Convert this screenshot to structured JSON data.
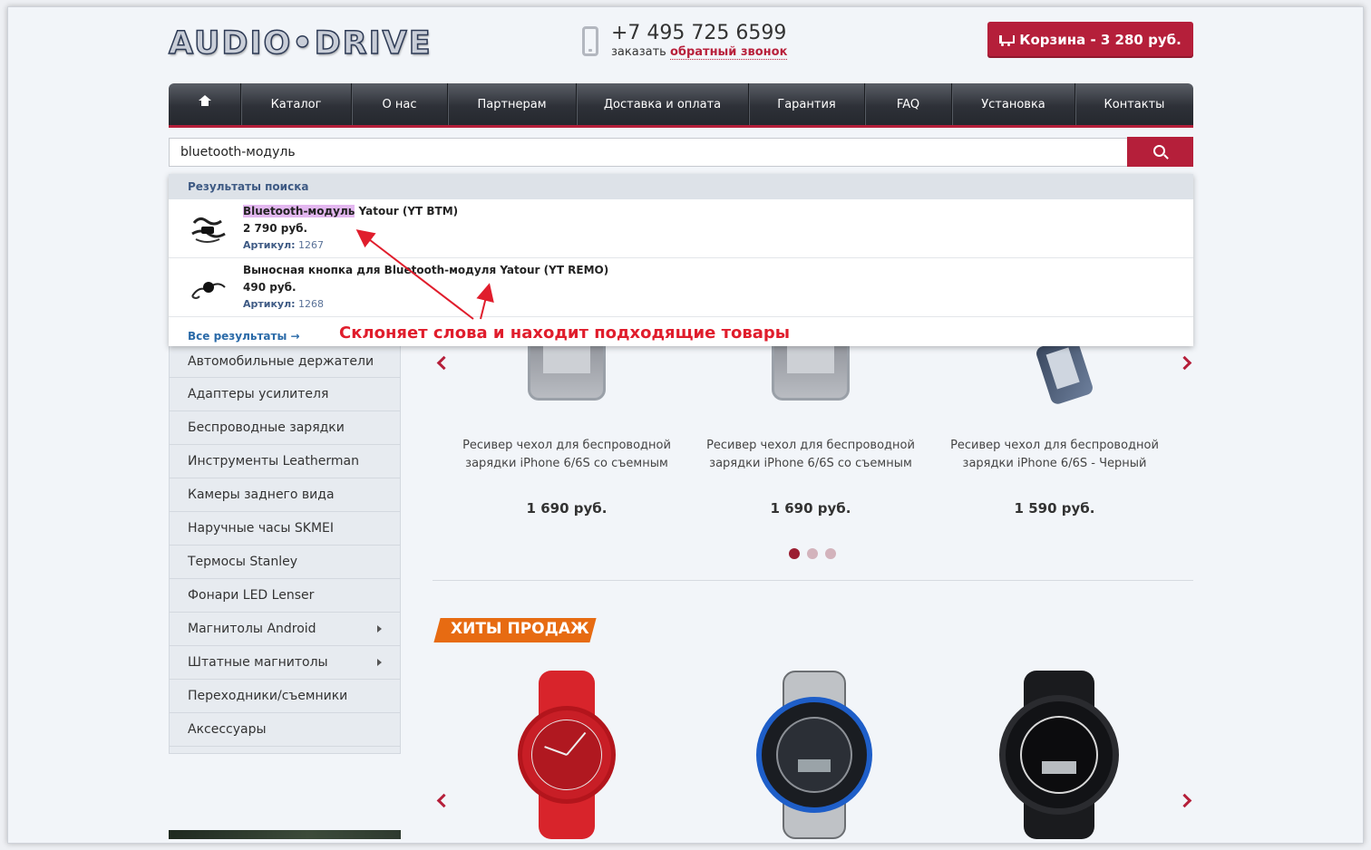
{
  "header": {
    "logo_text": "AUDIO•DRIVE",
    "phone": "+7 495 725 6599",
    "callback_prefix": "заказать",
    "callback_link": "обратный звонок",
    "cart_label": "Корзина -  3 280 руб."
  },
  "nav": {
    "items": [
      "Каталог",
      "О нас",
      "Партнерам",
      "Доставка и оплата",
      "Гарантия",
      "FAQ",
      "Установка",
      "Контакты"
    ]
  },
  "search": {
    "value": "bluetooth-модуль"
  },
  "dropdown": {
    "heading": "Результаты поиска",
    "results": [
      {
        "name_highlight": "Bluetooth-модуль",
        "name_rest": " Yatour (YT BTM)",
        "price": "2 790 руб.",
        "sku_label": "Артикул:",
        "sku": " 1267"
      },
      {
        "name_highlight": "",
        "name_rest": "Выносная кнопка для Bluetooth-модуля Yatour (YT REMO)",
        "price": "490 руб.",
        "sku_label": "Артикул:",
        "sku": " 1268"
      }
    ],
    "all_results": "Все результаты →"
  },
  "annotation": "Склоняет слова и находит подходящие товары",
  "sidebar": {
    "items": [
      "Автомобильные держатели",
      "Адаптеры усилителя",
      "Беспроводные зарядки",
      "Инструменты Leatherman",
      "Камеры заднего вида",
      "Наручные часы SKMEI",
      "Термосы Stanley",
      "Фонари LED Lenser",
      "Магнитолы Android",
      "Штатные магнитолы",
      "Переходники/съемники",
      "Аксессуары"
    ]
  },
  "carousel": {
    "products": [
      {
        "name": "Ресивер чехол для беспроводной зарядки iPhone 6/6S со съемным",
        "price": "1 690 руб."
      },
      {
        "name": "Ресивер чехол для беспроводной зарядки iPhone 6/6S со съемным",
        "price": "1 690 руб."
      },
      {
        "name": "Ресивер чехол для беспроводной зарядки iPhone 6/6S - Черный",
        "price": "1 590 руб."
      }
    ],
    "current_slide": 1,
    "total_slides": 3
  },
  "hits": {
    "title": "ХИТЫ ПРОДАЖ"
  },
  "colors": {
    "accent": "#b51f3a",
    "annotation": "#e01d2c",
    "hits_badge": "#e76b12",
    "link": "#2a6aa8"
  },
  "icons": [
    "home-icon",
    "cart-icon",
    "phone-icon",
    "search-icon",
    "chevron-left-icon",
    "chevron-right-icon",
    "caret-right-icon"
  ]
}
